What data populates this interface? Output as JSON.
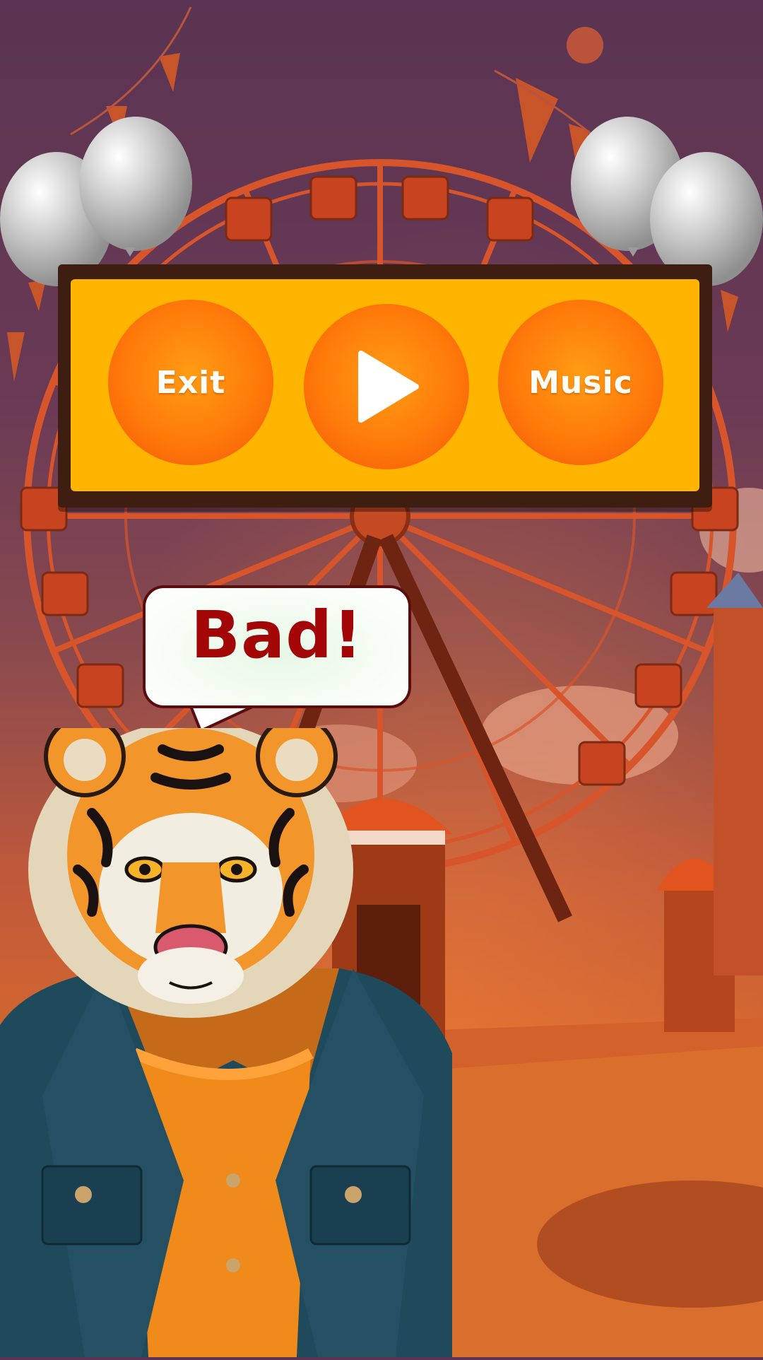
{
  "menu": {
    "exit_label": "Exit",
    "play_label": "",
    "music_label": "Music"
  },
  "speech_bubble": {
    "text": "Bad!"
  },
  "icons": {
    "play": "play-icon",
    "balloons": "balloon-icon",
    "character": "tiger-character"
  },
  "colors": {
    "panel_border": "#3e1e10",
    "panel_fill": "#ffb400",
    "button": "#ff7a0a",
    "bubble_text": "#a30606",
    "sky": "#5a3452"
  }
}
